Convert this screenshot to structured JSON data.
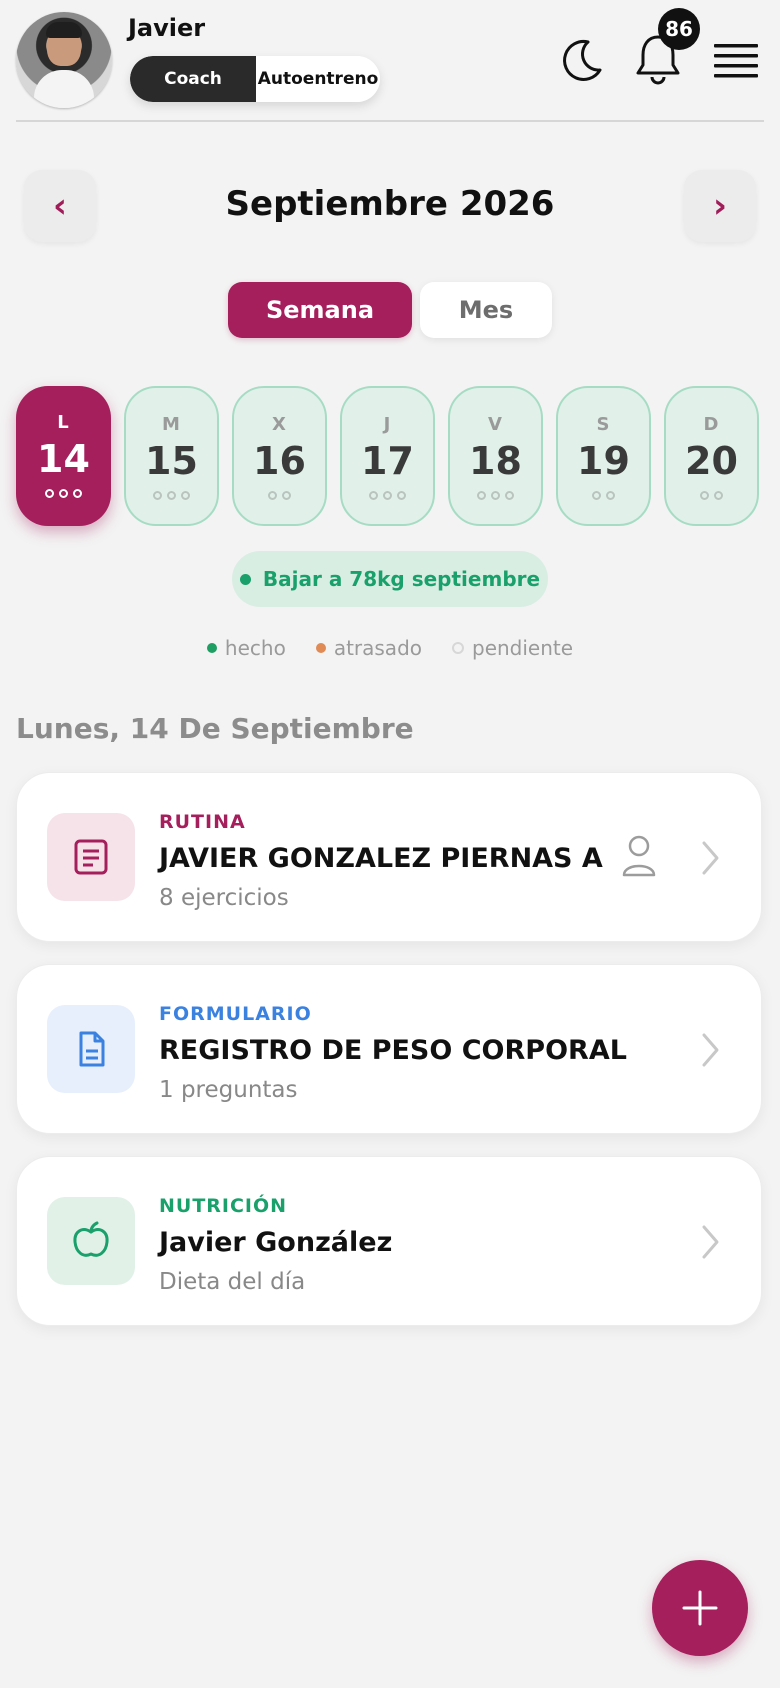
{
  "header": {
    "user_name": "Javier",
    "mode_toggle": {
      "active": "Coach",
      "inactive": "Autoentreno"
    },
    "notifications_count": "86",
    "icons": [
      "moon-icon",
      "bell-icon",
      "menu-icon"
    ]
  },
  "calendar": {
    "month_title": "Septiembre 2026",
    "prev_label": "‹",
    "next_label": "›",
    "view_toggle": {
      "week": "Semana",
      "month": "Mes"
    },
    "days": [
      {
        "letter": "L",
        "num": "14",
        "dots": 3,
        "selected": true
      },
      {
        "letter": "M",
        "num": "15",
        "dots": 3,
        "selected": false
      },
      {
        "letter": "X",
        "num": "16",
        "dots": 2,
        "selected": false
      },
      {
        "letter": "J",
        "num": "17",
        "dots": 3,
        "selected": false
      },
      {
        "letter": "V",
        "num": "18",
        "dots": 3,
        "selected": false
      },
      {
        "letter": "S",
        "num": "19",
        "dots": 2,
        "selected": false
      },
      {
        "letter": "D",
        "num": "20",
        "dots": 2,
        "selected": false
      }
    ]
  },
  "goal": {
    "label": "Bajar a 78kg septiembre"
  },
  "legend": [
    {
      "label": "hecho",
      "color": "#1e9e63"
    },
    {
      "label": "atrasado",
      "color": "#e08a55"
    },
    {
      "label": "pendiente",
      "color": "#d7d7d7"
    }
  ],
  "date_heading": "Lunes, 14 De Septiembre",
  "cards": [
    {
      "category": "RUTINA",
      "category_color": "#a41f5c",
      "title": "JAVIER GONZALEZ PIERNAS A",
      "subtitle": "8 ejercicios",
      "icon": "routine-icon",
      "icon_bg": "#f6e3ea"
    },
    {
      "category": "FORMULARIO",
      "category_color": "#3b82e0",
      "title": "REGISTRO DE PESO CORPORAL",
      "subtitle": "1 preguntas",
      "icon": "document-icon",
      "icon_bg": "#e7effd"
    },
    {
      "category": "NUTRICIÓN",
      "category_color": "#1aa06b",
      "title": "Javier González",
      "subtitle": "Dieta del día",
      "icon": "apple-icon",
      "icon_bg": "#e2f1e8"
    }
  ],
  "fab": {
    "icon": "plus-icon"
  }
}
